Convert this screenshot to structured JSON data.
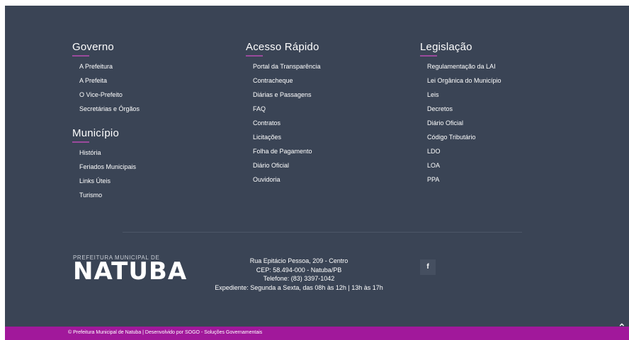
{
  "columns": {
    "governo": {
      "title": "Governo",
      "items": [
        "A Prefeitura",
        "A Prefeita",
        "O Vice-Prefeito",
        "Secretárias e Órgãos"
      ]
    },
    "municipio": {
      "title": "Município",
      "items": [
        "História",
        "Feriados Municipais",
        "Links Úteis",
        "Turismo"
      ]
    },
    "acesso": {
      "title": "Acesso Rápido",
      "items": [
        "Portal da Transparência",
        "Contracheque",
        "Diárias e Passagens",
        "FAQ",
        "Contratos",
        "Licitações",
        "Folha de Pagamento",
        "Diário Oficial",
        "Ouvidoria"
      ]
    },
    "legislacao": {
      "title": "Legislação",
      "items": [
        "Regulamentação da LAI",
        "Lei Orgânica do Município",
        "Leis",
        "Decretos",
        "Diário Oficial",
        "Código Tributário",
        "LDO",
        "LOA",
        "PPA"
      ]
    }
  },
  "logo": {
    "small": "PREFEITURA MUNICIPAL DE",
    "big": "NATUBA"
  },
  "address": {
    "line1": "Rua Epitácio Pessoa, 209 - Centro",
    "line2": "CEP: 58.494-000 - Natuba/PB",
    "line3": "Telefone: (83) 3397-1042",
    "line4": "Expediente: Segunda a Sexta, das 08h às 12h | 13h às 17h"
  },
  "social": {
    "facebook": "f"
  },
  "bottom_bar": {
    "text": "© Prefeitura Municipal de Natuba | Desenvolvido por SOGO - Soluções Governamentais"
  },
  "back_to_top": "⌃",
  "colors": {
    "footer_bg": "#3a4455",
    "accent": "#a1189b",
    "underline": "#9b4a9c"
  }
}
